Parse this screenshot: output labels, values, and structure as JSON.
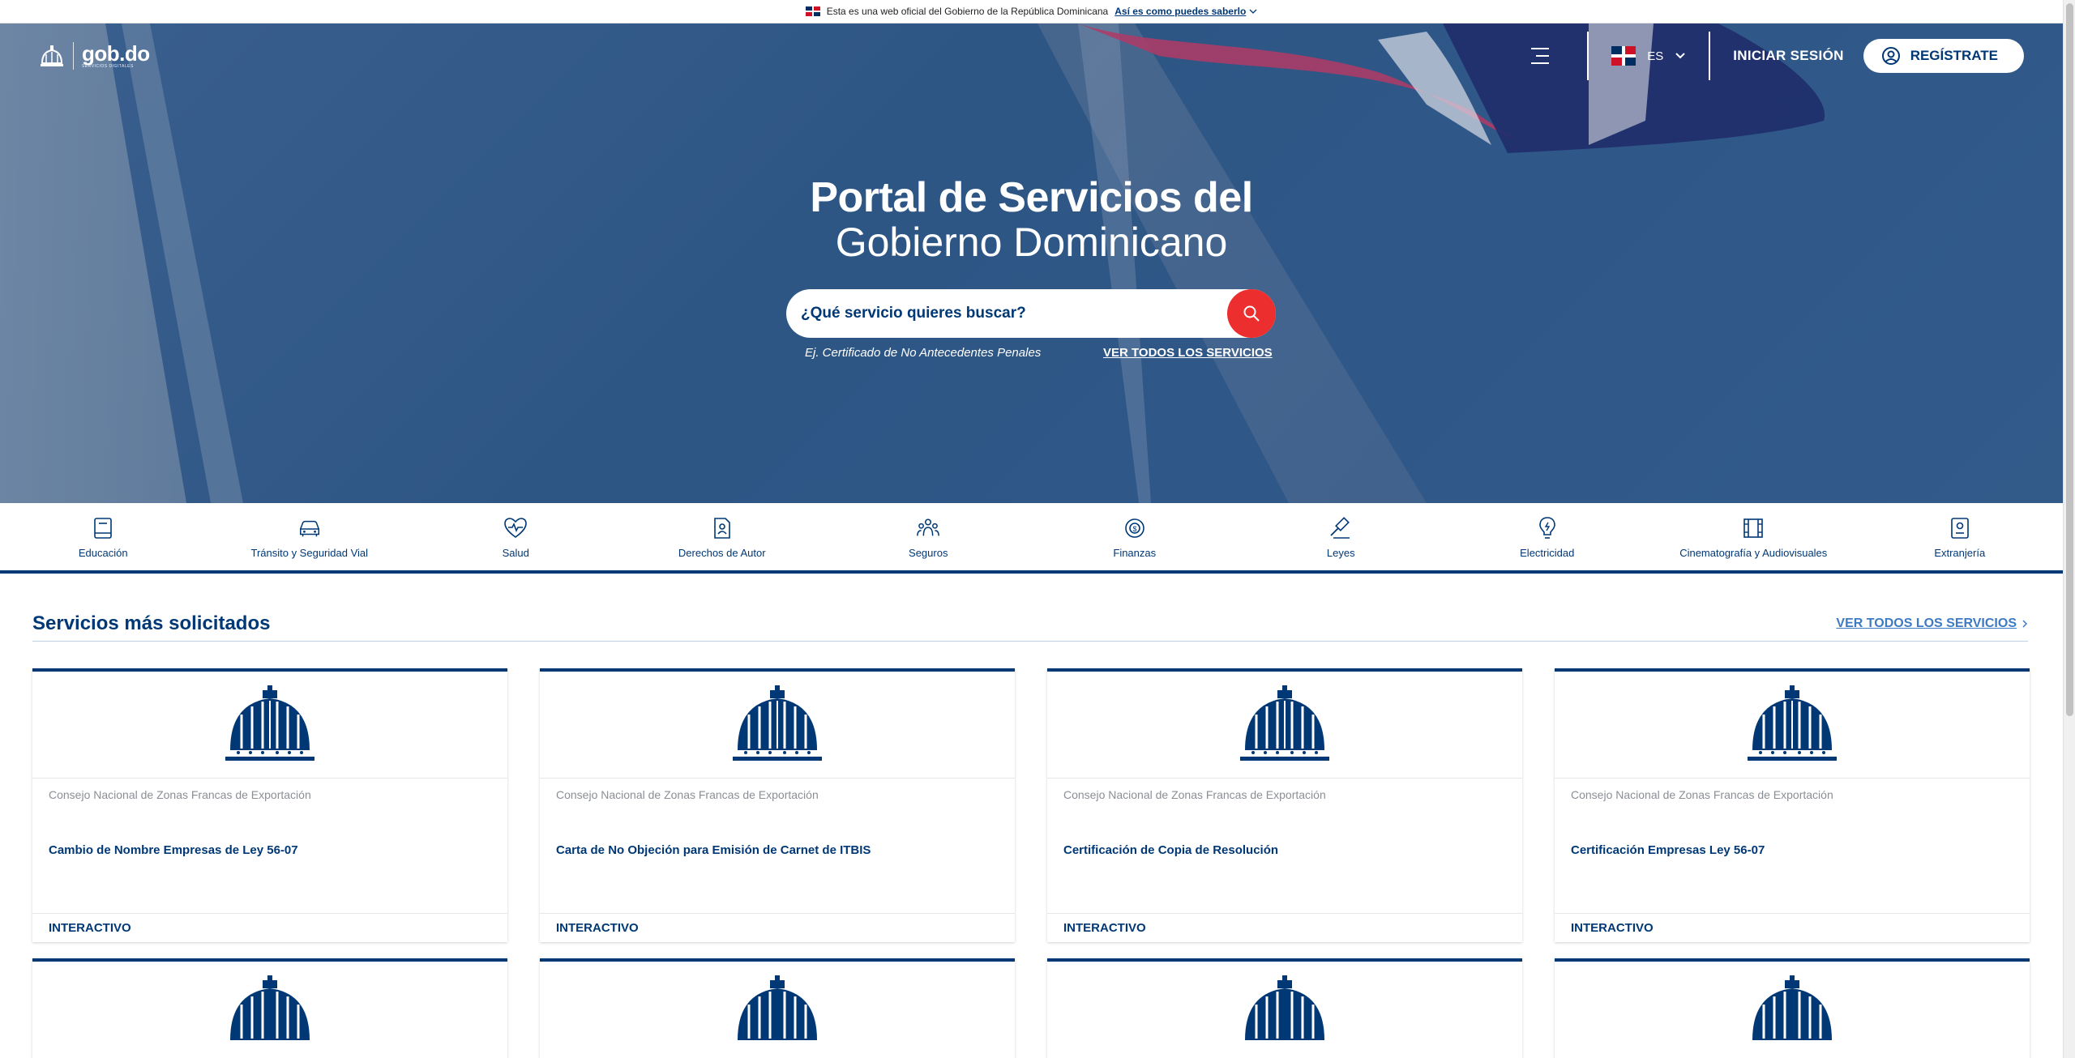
{
  "official_banner": {
    "text": "Esta es una web oficial del Gobierno de la República Dominicana",
    "link": "Así es como puedes saberlo"
  },
  "header": {
    "logo_text": "gob.do",
    "logo_sub": "SERVICIOS DIGITALES",
    "language": "ES",
    "login": "INICIAR SESIÓN",
    "register": "REGÍSTRATE"
  },
  "hero": {
    "title_line1": "Portal de Servicios del",
    "title_line2": "Gobierno Dominicano",
    "search_placeholder": "¿Qué servicio quieres buscar?",
    "hint": "Ej. Certificado de No Antecedentes Penales",
    "all_services": "VER TODOS LOS SERVICIOS"
  },
  "categories": [
    {
      "label": "Educación",
      "icon": "book-icon"
    },
    {
      "label": "Tránsito y Seguridad Vial",
      "icon": "car-icon"
    },
    {
      "label": "Salud",
      "icon": "heart-pulse-icon"
    },
    {
      "label": "Derechos de Autor",
      "icon": "author-document-icon"
    },
    {
      "label": "Seguros",
      "icon": "people-icon"
    },
    {
      "label": "Finanzas",
      "icon": "coins-icon"
    },
    {
      "label": "Leyes",
      "icon": "gavel-icon"
    },
    {
      "label": "Electricidad",
      "icon": "lightbulb-icon"
    },
    {
      "label": "Cinematografía y Audiovisuales",
      "icon": "film-icon"
    },
    {
      "label": "Extranjería",
      "icon": "id-card-icon"
    }
  ],
  "services_section": {
    "title": "Servicios más solicitados",
    "all_link": "VER TODOS LOS SERVICIOS"
  },
  "services": [
    {
      "org": "Consejo Nacional de Zonas Francas de Exportación",
      "name": "Cambio de Nombre Empresas de Ley 56-07",
      "type": "INTERACTIVO"
    },
    {
      "org": "Consejo Nacional de Zonas Francas de Exportación",
      "name": "Carta de No Objeción para Emisión de Carnet de ITBIS",
      "type": "INTERACTIVO"
    },
    {
      "org": "Consejo Nacional de Zonas Francas de Exportación",
      "name": "Certificación de Copia de Resolución",
      "type": "INTERACTIVO"
    },
    {
      "org": "Consejo Nacional de Zonas Francas de Exportación",
      "name": "Certificación Empresas Ley 56-07",
      "type": "INTERACTIVO"
    }
  ],
  "colors": {
    "brand": "#003876",
    "accent_red": "#ec2e2e",
    "link_blue": "#3c7ac4"
  }
}
